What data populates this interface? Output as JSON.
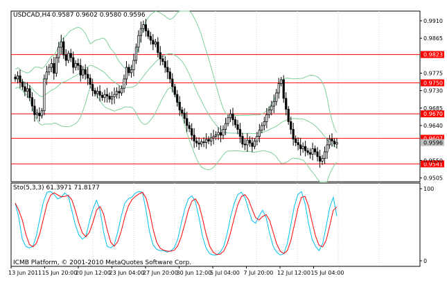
{
  "chart_data": [
    {
      "type": "candlestick",
      "instrument_label": "USDCAD,H4",
      "ohlc_header": "0.9587 0.9602 0.9580 0.9596",
      "yticks": [
        "0.9910",
        "0.9865",
        "0.9775",
        "0.9730",
        "0.9685",
        "0.9640",
        "0.9550",
        "0.9505"
      ],
      "last_price_label": "0.9596",
      "ylim": [
        0.9495,
        0.9935
      ],
      "horizontal_levels": [
        {
          "value": 0.9823,
          "label": "0.9823"
        },
        {
          "value": 0.975,
          "label": "0.9750"
        },
        {
          "value": 0.967,
          "label": "0.9670"
        },
        {
          "value": 0.9607,
          "label": "0.9607"
        },
        {
          "value": 0.9541,
          "label": "0.9541"
        }
      ],
      "bollinger_bands": true,
      "candles_close": [
        0.976,
        0.9768,
        0.9752,
        0.974,
        0.9728,
        0.9735,
        0.9712,
        0.969,
        0.9668,
        0.9672,
        0.9665,
        0.9678,
        0.976,
        0.9778,
        0.979,
        0.98,
        0.9775,
        0.9815,
        0.9842,
        0.9856,
        0.9822,
        0.9808,
        0.9826,
        0.9815,
        0.979,
        0.98,
        0.9795,
        0.977,
        0.9784,
        0.9772,
        0.9762,
        0.9746,
        0.973,
        0.9722,
        0.9728,
        0.9718,
        0.9712,
        0.972,
        0.9716,
        0.9708,
        0.9714,
        0.972,
        0.9728,
        0.9724,
        0.9736,
        0.976,
        0.979,
        0.9776,
        0.9784,
        0.9808,
        0.9842,
        0.9872,
        0.989,
        0.99,
        0.9884,
        0.987,
        0.986,
        0.985,
        0.9855,
        0.9828,
        0.9812,
        0.9805,
        0.979,
        0.9778,
        0.976,
        0.974,
        0.972,
        0.97,
        0.968,
        0.9672,
        0.9658,
        0.964,
        0.9632,
        0.9615,
        0.96,
        0.9595,
        0.9592,
        0.9598,
        0.9596,
        0.9604,
        0.96,
        0.9608,
        0.9612,
        0.9616,
        0.9622,
        0.9615,
        0.963,
        0.9645,
        0.966,
        0.967,
        0.9655,
        0.9642,
        0.963,
        0.9612,
        0.9592,
        0.959,
        0.9602,
        0.9595,
        0.9586,
        0.96,
        0.9612,
        0.9628,
        0.964,
        0.965,
        0.9668,
        0.968,
        0.969,
        0.9702,
        0.9724,
        0.9748,
        0.9758,
        0.971,
        0.9682,
        0.965,
        0.963,
        0.9605,
        0.9596,
        0.959,
        0.958,
        0.9586,
        0.9575,
        0.957,
        0.9566,
        0.958,
        0.9572,
        0.956,
        0.9548,
        0.9555,
        0.9572,
        0.959,
        0.9605,
        0.96,
        0.9592,
        0.9596
      ],
      "xtick_labels": [
        "13 Jun 2011",
        "15 Jun 20:00",
        "20 Jun 12:00",
        "23 Jun 04:00",
        "27 Jun 20:00",
        "30 Jun 12:00",
        "5 Jul 04:00",
        "7 Jul 20:00",
        "12 Jul 12:00",
        "15 Jul 04:00"
      ]
    },
    {
      "type": "line",
      "indicator_label": "Sto(5,3,3) 61.3971 71.8177",
      "yticks": [
        "100",
        "0"
      ],
      "ylim": [
        0,
        100
      ],
      "series_colors": {
        "main": "#00c0f0",
        "signal": "#ff0000"
      },
      "main_values": [
        80,
        60,
        30,
        20,
        18,
        20,
        35,
        60,
        82,
        95,
        96,
        92,
        86,
        88,
        94,
        90,
        70,
        50,
        36,
        30,
        34,
        55,
        72,
        84,
        70,
        40,
        20,
        18,
        22,
        40,
        62,
        80,
        86,
        88,
        94,
        96,
        95,
        70,
        40,
        22,
        16,
        14,
        14,
        12,
        14,
        18,
        30,
        52,
        72,
        86,
        90,
        82,
        60,
        34,
        18,
        10,
        8,
        8,
        12,
        20,
        38,
        62,
        80,
        92,
        95,
        88,
        72,
        56,
        52,
        62,
        70,
        60,
        38,
        20,
        12,
        8,
        10,
        24,
        50,
        76,
        92,
        96,
        80,
        52,
        30,
        20,
        14,
        24,
        48,
        74,
        88,
        62
      ]
    }
  ],
  "footer": {
    "copyright": "ICMB Platform, © 2001-2010 MetaQuotes Software Corp."
  },
  "colors": {
    "background": "#ffffff",
    "grid": "#d3d3d3",
    "axis": "#000000",
    "level_line": "#ff0000",
    "level_label_bg": "#ff0000",
    "bollinger": "#7fcf9a",
    "last_price_bg": "#c0c0c0",
    "candle": "#000000"
  }
}
